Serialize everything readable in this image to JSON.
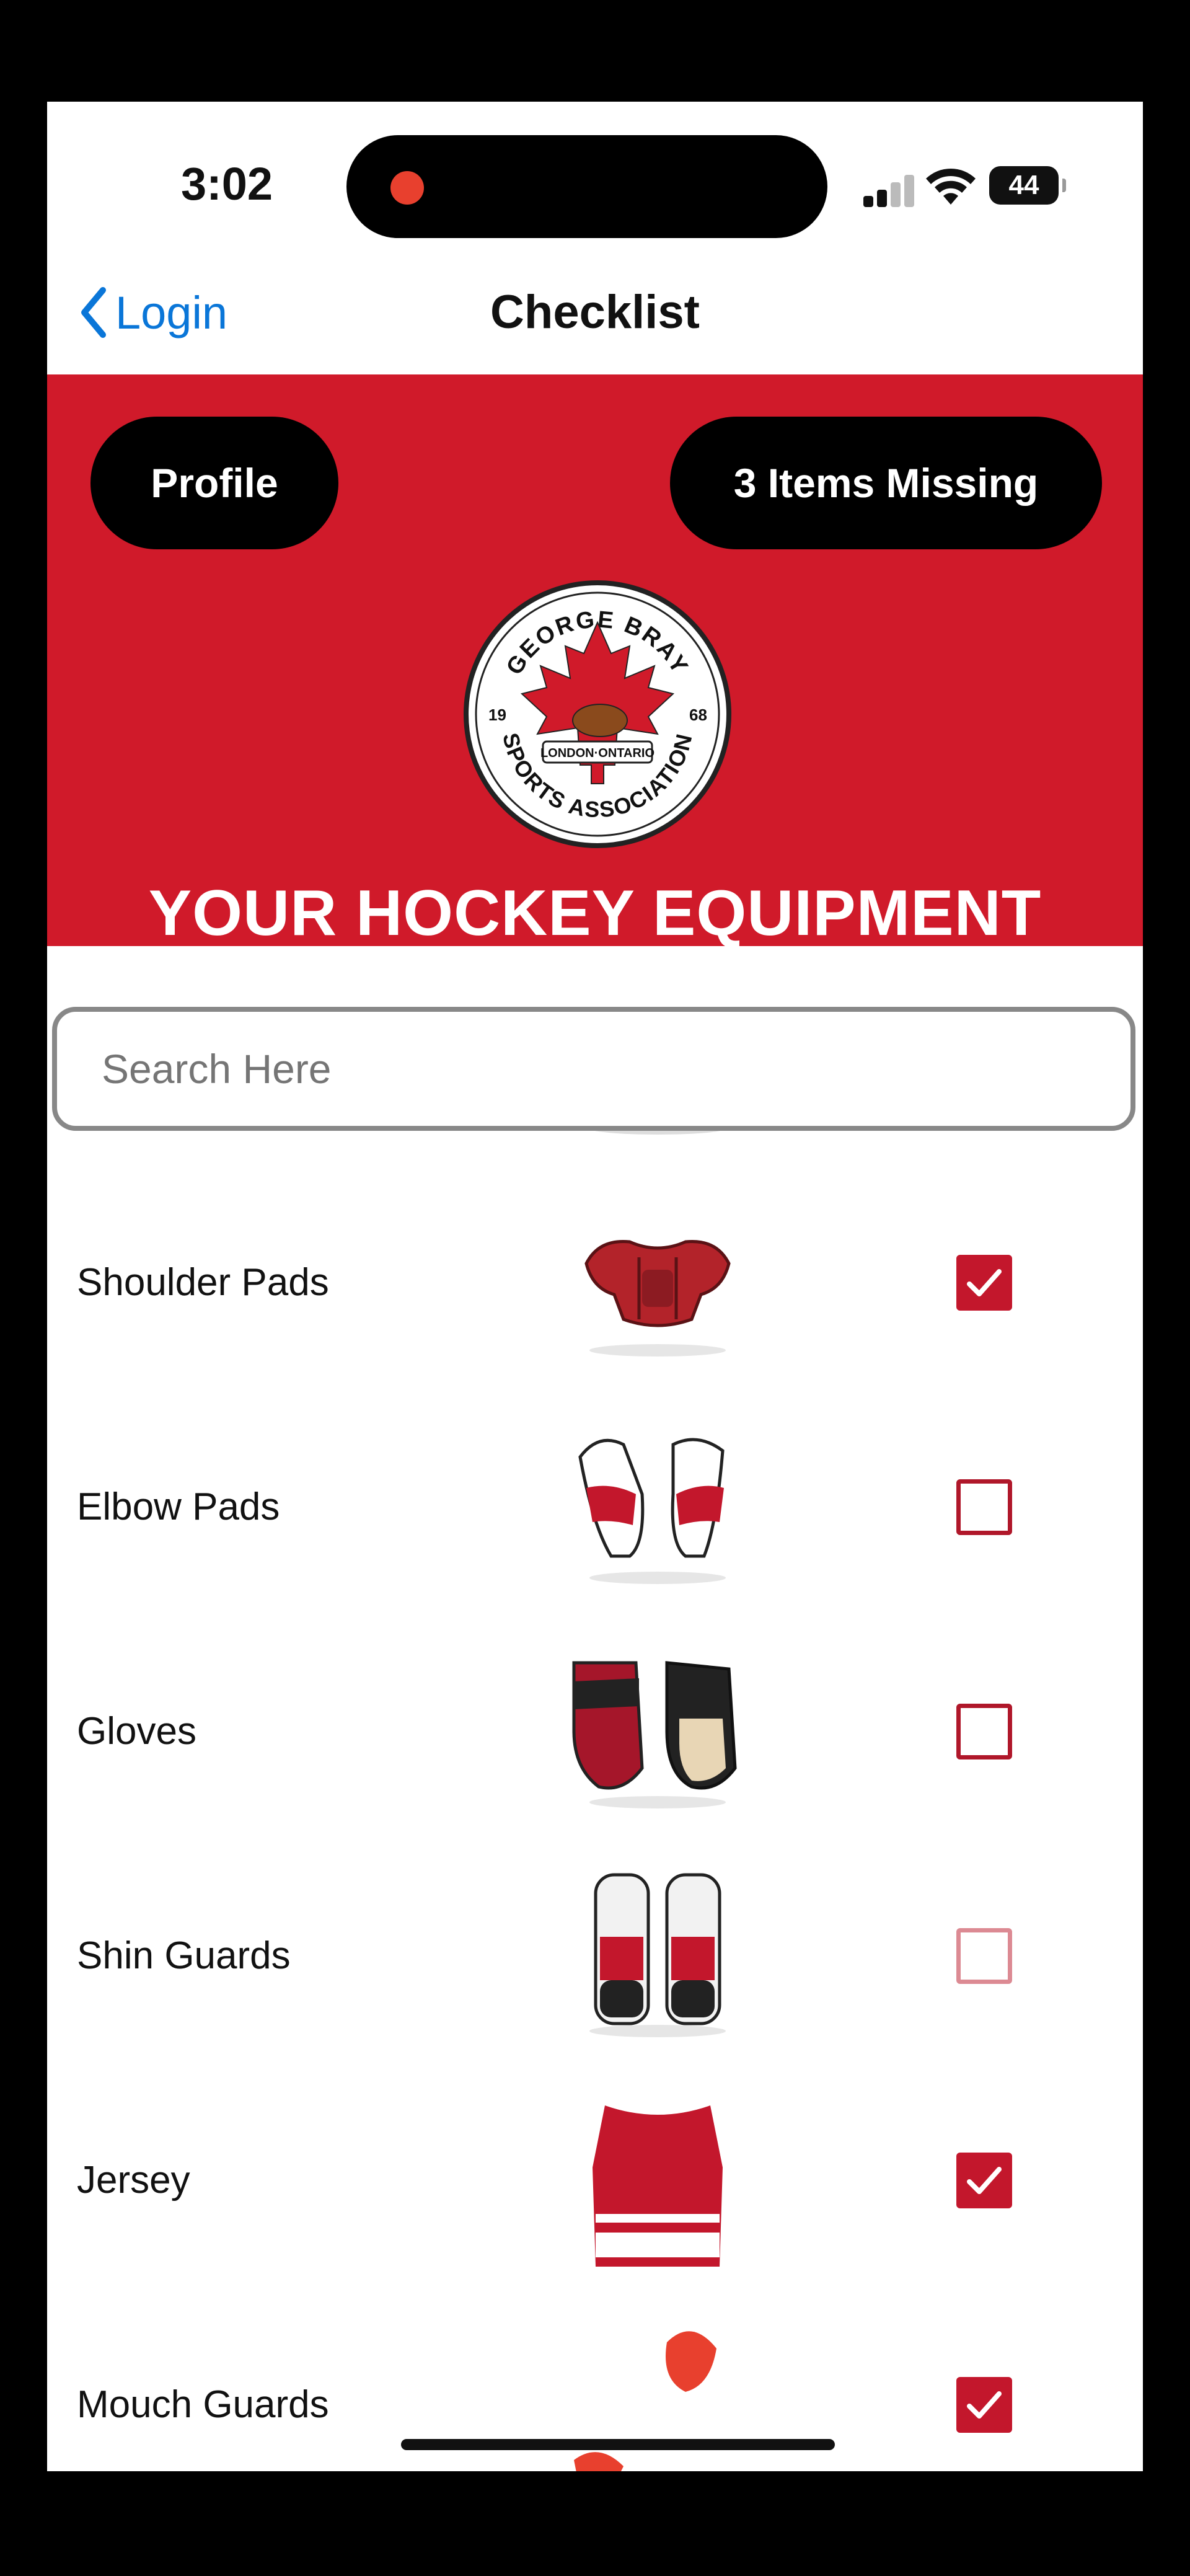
{
  "status_bar": {
    "time": "3:02",
    "battery": "44"
  },
  "nav": {
    "back_label": "Login",
    "title": "Checklist"
  },
  "header": {
    "profile_button": "Profile",
    "missing_button": "3 Items Missing",
    "logo": {
      "top_text": "GEORGE BRAY",
      "bottom_text": "SPORTS ASSOCIATION",
      "band_text": "LONDON·ONTARIO",
      "year_left": "19",
      "year_right": "68"
    },
    "title": "YOUR HOCKEY EQUIPMENT"
  },
  "search": {
    "placeholder": "Search Here"
  },
  "items": [
    {
      "label": "",
      "icon": "helmet-cage-image",
      "checked": true
    },
    {
      "label": "Shoulder Pads",
      "icon": "shoulder-pads-image",
      "checked": true
    },
    {
      "label": "Elbow Pads",
      "icon": "elbow-pads-image",
      "checked": false
    },
    {
      "label": "Gloves",
      "icon": "gloves-image",
      "checked": false
    },
    {
      "label": "Shin Guards",
      "icon": "shin-guards-image",
      "checked": false
    },
    {
      "label": "Jersey",
      "icon": "jersey-image",
      "checked": true
    },
    {
      "label": "Mouch Guards",
      "icon": "mouth-guard-image",
      "checked": true
    }
  ],
  "colors": {
    "brand_red": "#d01a2a",
    "link_blue": "#0a76d8",
    "checkbox_red": "#c3172c"
  }
}
